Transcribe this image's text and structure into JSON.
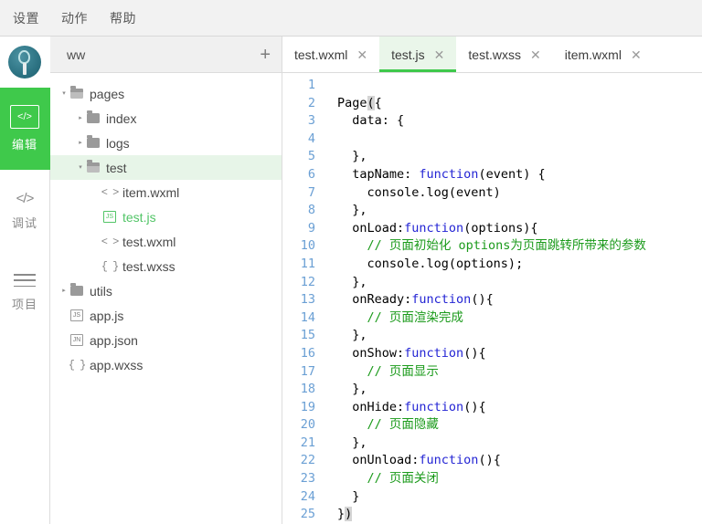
{
  "menubar": {
    "items": [
      {
        "label": "设置",
        "name": "menu-settings"
      },
      {
        "label": "动作",
        "name": "menu-actions"
      },
      {
        "label": "帮助",
        "name": "menu-help"
      }
    ]
  },
  "activity_bar": {
    "avatar_alt": "user-avatar",
    "items": [
      {
        "label": "编辑",
        "icon": "</>",
        "active": true
      },
      {
        "label": "调试",
        "icon": "</>",
        "active": false
      },
      {
        "label": "项目",
        "icon": "hamburger",
        "active": false
      }
    ],
    "active_color": "#3fc94b"
  },
  "explorer": {
    "title": "ww",
    "add_label": "+",
    "tree": [
      {
        "label": "pages",
        "type": "folder-open",
        "depth": 0,
        "caret": "▾",
        "selected": false
      },
      {
        "label": "index",
        "type": "folder-closed",
        "depth": 1,
        "caret": "▸",
        "selected": false
      },
      {
        "label": "logs",
        "type": "folder-closed",
        "depth": 1,
        "caret": "▸",
        "selected": false
      },
      {
        "label": "test",
        "type": "folder-open",
        "depth": 1,
        "caret": "▾",
        "selected": true
      },
      {
        "label": "item.wxml",
        "type": "wxml",
        "depth": 2,
        "caret": "",
        "selected": false
      },
      {
        "label": "test.js",
        "type": "js-active",
        "depth": 2,
        "caret": "",
        "selected": false,
        "active_file": true
      },
      {
        "label": "test.wxml",
        "type": "wxml",
        "depth": 2,
        "caret": "",
        "selected": false
      },
      {
        "label": "test.wxss",
        "type": "wxss",
        "depth": 2,
        "caret": "",
        "selected": false
      },
      {
        "label": "utils",
        "type": "folder-closed",
        "depth": 0,
        "caret": "▸",
        "selected": false
      },
      {
        "label": "app.js",
        "type": "js",
        "depth": 0,
        "caret": "",
        "selected": false
      },
      {
        "label": "app.json",
        "type": "json",
        "depth": 0,
        "caret": "",
        "selected": false
      },
      {
        "label": "app.wxss",
        "type": "wxss",
        "depth": 0,
        "caret": "",
        "selected": false
      }
    ]
  },
  "editor": {
    "tabs": [
      {
        "label": "test.wxml",
        "close": "✕",
        "active": false
      },
      {
        "label": "test.js",
        "close": "✕",
        "active": true
      },
      {
        "label": "test.wxss",
        "close": "✕",
        "active": false
      },
      {
        "label": "item.wxml",
        "close": "✕",
        "active": false
      }
    ],
    "line_numbers": [
      1,
      2,
      3,
      4,
      5,
      6,
      7,
      8,
      9,
      10,
      11,
      12,
      13,
      14,
      15,
      16,
      17,
      18,
      19,
      20,
      21,
      22,
      23,
      24,
      25
    ],
    "code": [
      [],
      [
        {
          "t": "Page",
          "c": "plain"
        },
        {
          "t": "(",
          "c": "hl"
        },
        {
          "t": "{",
          "c": "plain"
        }
      ],
      [
        {
          "t": "  data: {",
          "c": "plain"
        }
      ],
      [],
      [
        {
          "t": "  },",
          "c": "plain"
        }
      ],
      [
        {
          "t": "  tapName: ",
          "c": "plain"
        },
        {
          "t": "function",
          "c": "kw"
        },
        {
          "t": "(event) {",
          "c": "plain"
        }
      ],
      [
        {
          "t": "    console.log(event)",
          "c": "plain"
        }
      ],
      [
        {
          "t": "  },",
          "c": "plain"
        }
      ],
      [
        {
          "t": "  onLoad:",
          "c": "plain"
        },
        {
          "t": "function",
          "c": "kw"
        },
        {
          "t": "(options){",
          "c": "plain"
        }
      ],
      [
        {
          "t": "    ",
          "c": "plain"
        },
        {
          "t": "// 页面初始化 options为页面跳转所带来的参数",
          "c": "cmt"
        }
      ],
      [
        {
          "t": "    console.log(options);",
          "c": "plain"
        }
      ],
      [
        {
          "t": "  },",
          "c": "plain"
        }
      ],
      [
        {
          "t": "  onReady:",
          "c": "plain"
        },
        {
          "t": "function",
          "c": "kw"
        },
        {
          "t": "(){",
          "c": "plain"
        }
      ],
      [
        {
          "t": "    ",
          "c": "plain"
        },
        {
          "t": "// 页面渲染完成",
          "c": "cmt"
        }
      ],
      [
        {
          "t": "  },",
          "c": "plain"
        }
      ],
      [
        {
          "t": "  onShow:",
          "c": "plain"
        },
        {
          "t": "function",
          "c": "kw"
        },
        {
          "t": "(){",
          "c": "plain"
        }
      ],
      [
        {
          "t": "    ",
          "c": "plain"
        },
        {
          "t": "// 页面显示",
          "c": "cmt"
        }
      ],
      [
        {
          "t": "  },",
          "c": "plain"
        }
      ],
      [
        {
          "t": "  onHide:",
          "c": "plain"
        },
        {
          "t": "function",
          "c": "kw"
        },
        {
          "t": "(){",
          "c": "plain"
        }
      ],
      [
        {
          "t": "    ",
          "c": "plain"
        },
        {
          "t": "// 页面隐藏",
          "c": "cmt"
        }
      ],
      [
        {
          "t": "  },",
          "c": "plain"
        }
      ],
      [
        {
          "t": "  onUnload:",
          "c": "plain"
        },
        {
          "t": "function",
          "c": "kw"
        },
        {
          "t": "(){",
          "c": "plain"
        }
      ],
      [
        {
          "t": "    ",
          "c": "plain"
        },
        {
          "t": "// 页面关闭",
          "c": "cmt"
        }
      ],
      [
        {
          "t": "  }",
          "c": "plain"
        }
      ],
      [
        {
          "t": "}",
          "c": "plain"
        },
        {
          "t": ")",
          "c": "hl"
        }
      ]
    ],
    "colors": {
      "keyword": "#2324d4",
      "comment": "#1a9a1a",
      "plain": "#000000",
      "line_number": "#6a9fd4",
      "active_tab_bg": "#eaf6ea",
      "active_tab_underline": "#3fc94b"
    }
  }
}
